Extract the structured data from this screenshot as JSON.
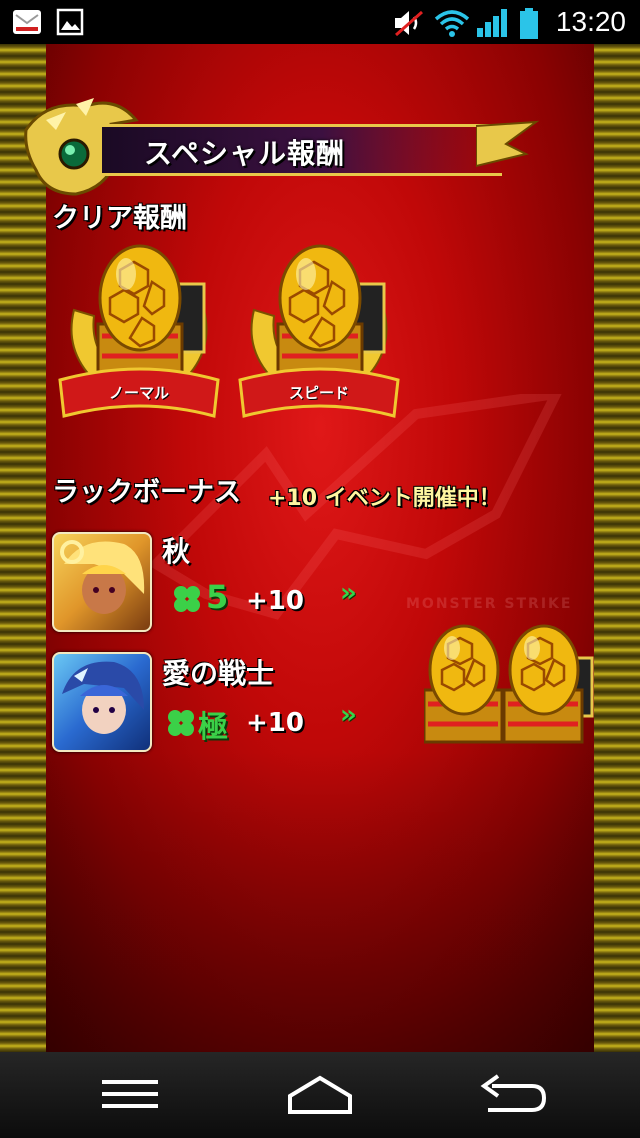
{
  "status_bar": {
    "time": "13:20",
    "icons": [
      "gmail-icon",
      "image-icon",
      "mute-icon",
      "wifi-icon",
      "signal-icon",
      "battery-icon"
    ]
  },
  "banner": {
    "title": "スペシャル報酬"
  },
  "clear_reward": {
    "heading": "クリア報酬",
    "items": [
      {
        "label": "ノーマル"
      },
      {
        "label": "スピード"
      }
    ]
  },
  "luck_bonus": {
    "heading": "ラックボーナス",
    "event": "+10 イベント開催中！",
    "characters": [
      {
        "name": "秋",
        "luck": "5",
        "bonus": "+10",
        "arrow": "»"
      },
      {
        "name": "愛の戦士",
        "luck": "極",
        "bonus": "+10",
        "arrow": "»"
      }
    ]
  },
  "watermark": "MONSTER STRIKE",
  "nav": {
    "icons": [
      "menu-icon",
      "home-icon",
      "back-icon"
    ]
  },
  "colors": {
    "background_red": "#c00808",
    "gold": "#e8c84a",
    "luck_green": "#3bd048"
  }
}
